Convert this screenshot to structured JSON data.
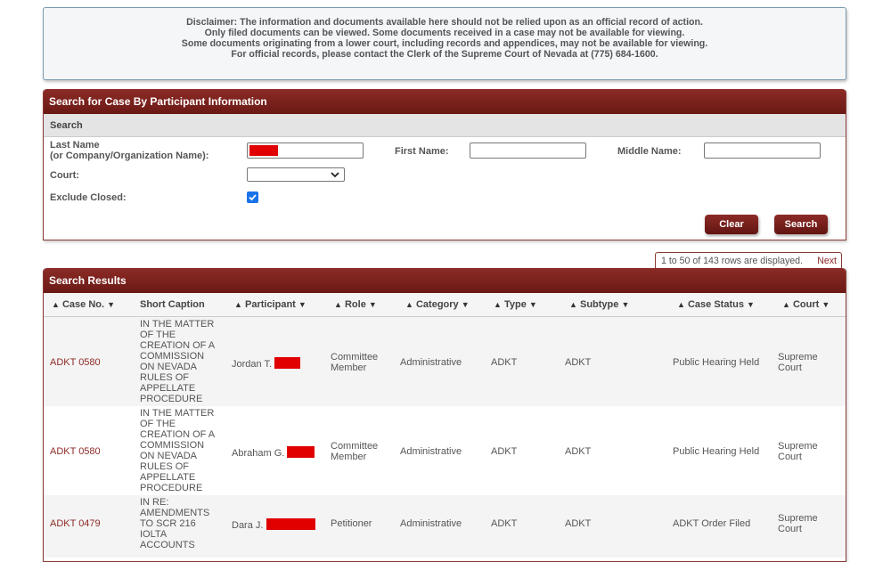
{
  "disclaimer": {
    "line1": "Disclaimer: The information and documents available here should not be relied upon as an official record of action.",
    "line2": "Only filed documents can be viewed. Some documents received in a case may not be available for viewing.",
    "line3": "Some documents originating from a lower court, including records and appendices, may not be available for viewing.",
    "line4": "For official records, please contact the Clerk of the Supreme Court of Nevada at (775) 684-1600."
  },
  "search_panel": {
    "title": "Search for Case By Participant Information",
    "subheader": "Search",
    "last_name_label_1": "Last Name",
    "last_name_label_2": "(or Company/Organization Name):",
    "first_name_label": "First Name:",
    "middle_name_label": "Middle Name:",
    "court_label": "Court:",
    "exclude_closed_label": "Exclude Closed:",
    "first_name_value": "",
    "middle_name_value": "",
    "court_value": "",
    "exclude_closed_checked": true,
    "clear_label": "Clear",
    "search_label": "Search"
  },
  "pagination": {
    "text": "1 to 50 of 143 rows are displayed.",
    "next_label": "Next"
  },
  "results": {
    "title": "Search Results",
    "columns": [
      "Case No.",
      "Short Caption",
      "Participant",
      "Role",
      "Category",
      "Type",
      "Subtype",
      "Case Status",
      "Court"
    ],
    "rows": [
      {
        "case_no": "ADKT 0580",
        "caption": [
          "IN THE MATTER",
          "OF THE",
          "CREATION OF A",
          "COMMISSION",
          "ON NEVADA",
          "RULES OF",
          "APPELLATE",
          "PROCEDURE"
        ],
        "participant": "Jordan T.",
        "role": [
          "Committee",
          "Member"
        ],
        "category": "Administrative",
        "type": "ADKT",
        "subtype": "ADKT",
        "status": "Public Hearing Held",
        "court": [
          "Supreme",
          "Court"
        ]
      },
      {
        "case_no": "ADKT 0580",
        "caption": [
          "IN THE MATTER",
          "OF THE",
          "CREATION OF A",
          "COMMISSION",
          "ON NEVADA",
          "RULES OF",
          "APPELLATE",
          "PROCEDURE"
        ],
        "participant": "Abraham G.",
        "role": [
          "Committee",
          "Member"
        ],
        "category": "Administrative",
        "type": "ADKT",
        "subtype": "ADKT",
        "status": "Public Hearing Held",
        "court": [
          "Supreme",
          "Court"
        ]
      },
      {
        "case_no": "ADKT 0479",
        "caption": [
          "IN RE:",
          "AMENDMENTS",
          "TO SCR 216",
          "IOLTA",
          "ACCOUNTS"
        ],
        "participant": "Dara J.",
        "role": [
          "Petitioner"
        ],
        "category": "Administrative",
        "type": "ADKT",
        "subtype": "ADKT",
        "status": "ADKT Order Filed",
        "court": [
          "Supreme",
          "Court"
        ]
      }
    ]
  },
  "colors": {
    "header_red": "#8c2b26",
    "redaction": "#e00000",
    "link": "#8c2b26",
    "checkbox": "#1a73e8"
  }
}
